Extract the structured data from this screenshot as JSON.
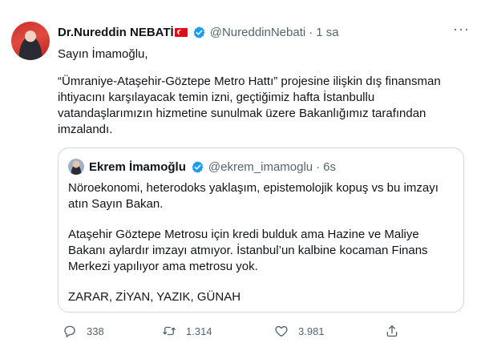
{
  "tweet": {
    "author_name": "Dr.Nureddin NEBATİ",
    "handle": "@NureddinNebati",
    "separator": "·",
    "time": "1 sa",
    "more_label": "···",
    "greeting": "Sayın İmamoğlu,",
    "body": "“Ümraniye-Ataşehir-Göztepe Metro Hattı” projesine ilişkin dış finansman ihtiyacını karşılayacak temin izni, geçtiğimiz hafta İstanbullu vatandaşlarımızın hizmetine sunulmak üzere Bakanlığımız tarafından imzalandı."
  },
  "quote": {
    "author_name": "Ekrem İmamoğlu",
    "handle": "@ekrem_imamoglu",
    "separator": "·",
    "time": "6s",
    "para1": "Nöroekonomi, heterodoks yaklaşım, epistemolojik kopuş vs bu imzayı atın Sayın Bakan.",
    "para2": "Ataşehir Göztepe Metrosu için kredi bulduk ama Hazine ve Maliye Bakanı aylardır imzayı atmıyor. İstanbul’un kalbine kocaman Finans Merkezi yapılıyor ama metrosu yok.",
    "para3": "ZARAR, ZİYAN, YAZIK, GÜNAH"
  },
  "actions": {
    "replies": "338",
    "retweets": "1.314",
    "likes": "3.981"
  },
  "colors": {
    "verified": "#1d9bf0",
    "muted": "#536471",
    "border": "#cfd9de",
    "flag_red": "#e30a17"
  },
  "icons": {
    "reply": "reply-icon",
    "retweet": "retweet-icon",
    "like": "heart-icon",
    "share": "share-icon",
    "verified": "verified-badge-icon",
    "flag": "turkey-flag-icon"
  }
}
